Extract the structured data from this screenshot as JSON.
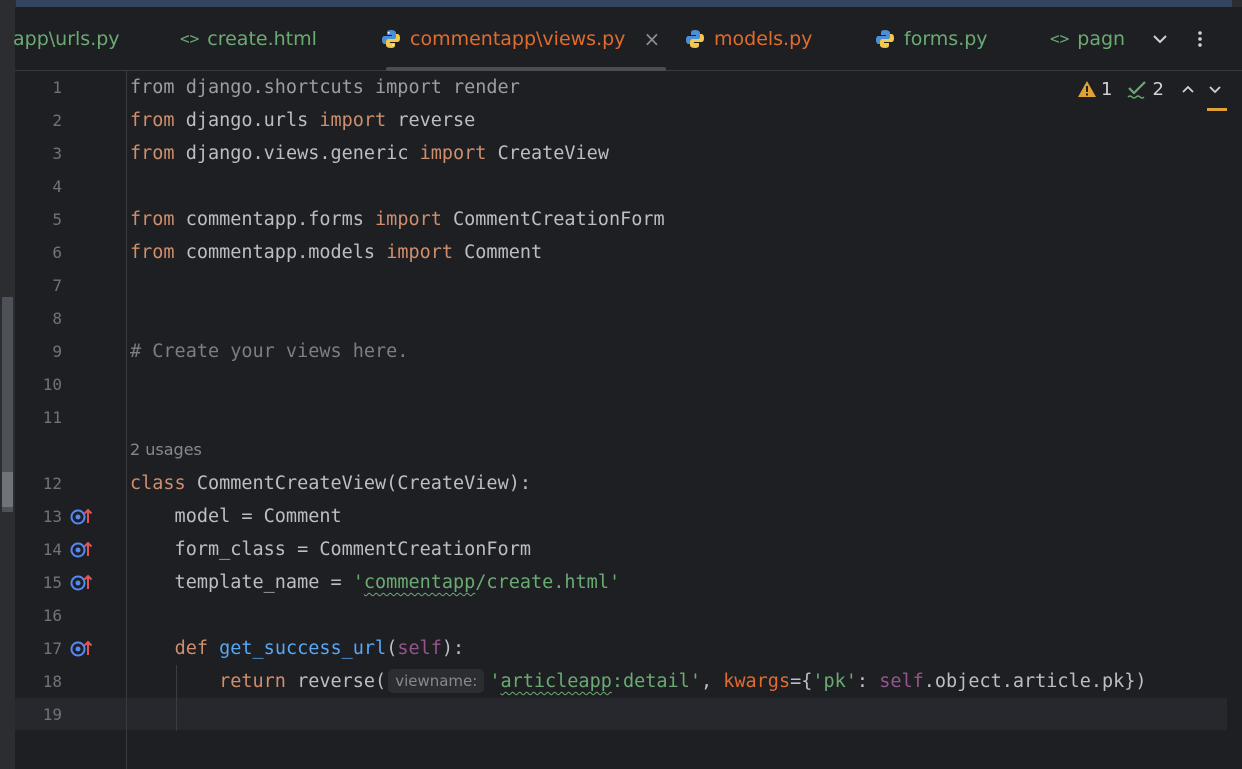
{
  "tabs": [
    {
      "label": "app\\urls.py",
      "icon": "python-icon",
      "color": "#6aab73",
      "icon_text": ""
    },
    {
      "label": "create.html",
      "icon": "html-icon",
      "color": "#6aab73",
      "icon_text": "<>"
    },
    {
      "label": "commentapp\\views.py",
      "icon": "python-icon",
      "color": "#e06c2e",
      "icon_text": "",
      "active": true
    },
    {
      "label": "models.py",
      "icon": "python-icon",
      "color": "#e06c2e",
      "icon_text": ""
    },
    {
      "label": "forms.py",
      "icon": "python-icon",
      "color": "#6aab73",
      "icon_text": ""
    },
    {
      "label": "pagn",
      "icon": "html-icon",
      "color": "#6aab73",
      "icon_text": "<>"
    }
  ],
  "tab_close": "×",
  "inspections": {
    "warnings": "1",
    "typos": "2"
  },
  "usages": "2 usages",
  "line_numbers": [
    "1",
    "2",
    "3",
    "4",
    "5",
    "6",
    "7",
    "8",
    "9",
    "10",
    "11",
    "12",
    "13",
    "14",
    "15",
    "16",
    "17",
    "18",
    "19"
  ],
  "code": {
    "l1": [
      {
        "t": "from django.shortcuts import render",
        "c": "dim"
      }
    ],
    "l2": [
      {
        "t": "from",
        "c": "kw"
      },
      {
        "t": " django.urls "
      },
      {
        "t": "import",
        "c": "kw"
      },
      {
        "t": " reverse"
      }
    ],
    "l3": [
      {
        "t": "from",
        "c": "kw"
      },
      {
        "t": " django.views.generic "
      },
      {
        "t": "import",
        "c": "kw"
      },
      {
        "t": " CreateView"
      }
    ],
    "l4": [],
    "l5": [
      {
        "t": "from",
        "c": "kw"
      },
      {
        "t": " commentapp.forms "
      },
      {
        "t": "import",
        "c": "kw"
      },
      {
        "t": " CommentCreationForm"
      }
    ],
    "l6": [
      {
        "t": "from",
        "c": "kw"
      },
      {
        "t": " commentapp.models "
      },
      {
        "t": "import",
        "c": "kw"
      },
      {
        "t": " Comment"
      }
    ],
    "l7": [],
    "l8": [],
    "l9": [
      {
        "t": "# Create your views here.",
        "c": "cmt"
      }
    ],
    "l10": [],
    "l11": [],
    "l12": [
      {
        "t": "class",
        "c": "kw"
      },
      {
        "t": " CommentCreateView(CreateView):"
      }
    ],
    "l13": [
      {
        "t": "    model = Comment"
      }
    ],
    "l14": [
      {
        "t": "    form_class = CommentCreationForm"
      }
    ],
    "l15": [
      {
        "t": "    template_name = "
      },
      {
        "t": "'",
        "c": "str"
      },
      {
        "t": "commentapp",
        "c": "str wavy"
      },
      {
        "t": "/create.html'",
        "c": "str"
      }
    ],
    "l16": [],
    "l17": [
      {
        "t": "    "
      },
      {
        "t": "def",
        "c": "kw"
      },
      {
        "t": " "
      },
      {
        "t": "get_success_url",
        "c": "fn"
      },
      {
        "t": "("
      },
      {
        "t": "self",
        "c": "self"
      },
      {
        "t": "):"
      }
    ],
    "l18": [
      {
        "t": "        "
      },
      {
        "t": "return",
        "c": "kw"
      },
      {
        "t": " reverse("
      },
      {
        "t": "viewname:",
        "c": "hint"
      },
      {
        "t": "'",
        "c": "str"
      },
      {
        "t": "articleapp",
        "c": "str wavy"
      },
      {
        "t": ":detail'",
        "c": "str"
      },
      {
        "t": ", "
      },
      {
        "t": "kwargs",
        "c": "kwarg"
      },
      {
        "t": "={"
      },
      {
        "t": "'pk'",
        "c": "str"
      },
      {
        "t": ": "
      },
      {
        "t": "self",
        "c": "self"
      },
      {
        "t": ".object.article.pk})"
      }
    ],
    "l19": []
  },
  "override_lines": [
    "13",
    "14",
    "15",
    "17"
  ],
  "colors": {
    "keyword": "#cf8e6d",
    "string": "#6aab73",
    "comment": "#7a7e85",
    "self": "#94558d",
    "function": "#56a8f5",
    "kwarg": "#e06c2e"
  }
}
